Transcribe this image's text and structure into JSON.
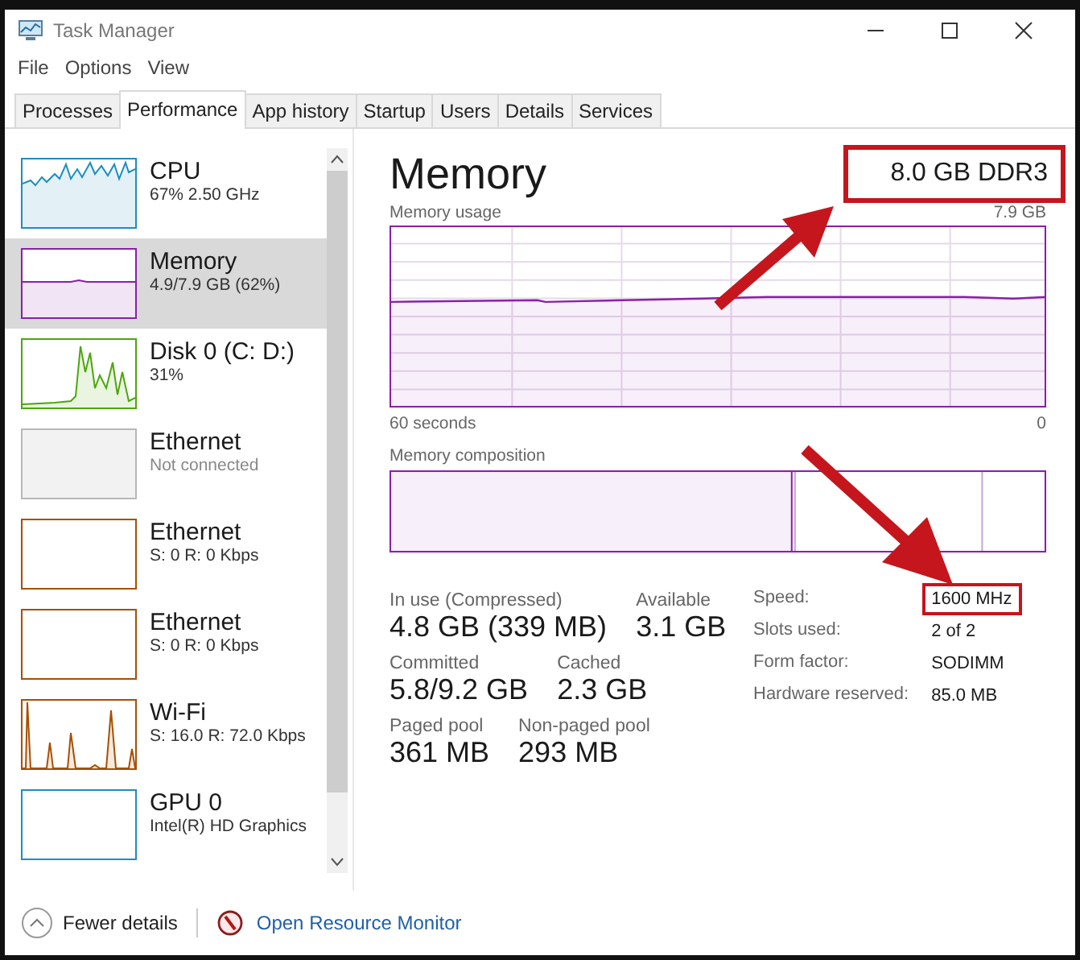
{
  "window": {
    "title": "Task Manager"
  },
  "menu": [
    "File",
    "Options",
    "View"
  ],
  "tabs": [
    {
      "label": "Processes",
      "selected": false
    },
    {
      "label": "Performance",
      "selected": true
    },
    {
      "label": "App history",
      "selected": false
    },
    {
      "label": "Startup",
      "selected": false
    },
    {
      "label": "Users",
      "selected": false
    },
    {
      "label": "Details",
      "selected": false
    },
    {
      "label": "Services",
      "selected": false
    }
  ],
  "sidebar": {
    "items": [
      {
        "name": "CPU",
        "detail": "67%  2.50 GHz",
        "kind": "cpu",
        "color": "#1c8ebf",
        "selected": false,
        "disabled": false
      },
      {
        "name": "Memory",
        "detail": "4.9/7.9 GB (62%)",
        "kind": "memory",
        "color": "#8b1fa8",
        "selected": true,
        "disabled": false
      },
      {
        "name": "Disk 0 (C: D:)",
        "detail": "31%",
        "kind": "disk",
        "color": "#4da60c",
        "selected": false,
        "disabled": false
      },
      {
        "name": "Ethernet",
        "detail": "Not connected",
        "kind": "empty",
        "color": "#b8b8b8",
        "selected": false,
        "disabled": true
      },
      {
        "name": "Ethernet",
        "detail": "S: 0 R: 0 Kbps",
        "kind": "empty",
        "color": "#a74f01",
        "selected": false,
        "disabled": false
      },
      {
        "name": "Ethernet",
        "detail": "S: 0 R: 0 Kbps",
        "kind": "empty",
        "color": "#a74f01",
        "selected": false,
        "disabled": false
      },
      {
        "name": "Wi-Fi",
        "detail": "S: 16.0 R: 72.0 Kbps",
        "kind": "wifi",
        "color": "#a74f01",
        "selected": false,
        "disabled": false
      },
      {
        "name": "GPU 0",
        "detail": "Intel(R) HD Graphics",
        "kind": "empty",
        "color": "#1c8ebf",
        "selected": false,
        "disabled": false
      }
    ]
  },
  "main": {
    "title": "Memory",
    "spec": "8.0 GB DDR3",
    "spec_highlighted": true,
    "usage_label": "Memory usage",
    "usage_max": "7.9 GB",
    "time_span": "60 seconds",
    "time_end": "0",
    "composition_label": "Memory composition",
    "stats": [
      {
        "label": "In use (Compressed)",
        "value": "4.8 GB (339 MB)"
      },
      {
        "label": "Available",
        "value": "3.1 GB"
      },
      {
        "label": "Committed",
        "value": "5.8/9.2 GB"
      },
      {
        "label": "Cached",
        "value": "2.3 GB"
      },
      {
        "label": "Paged pool",
        "value": "361 MB"
      },
      {
        "label": "Non-paged pool",
        "value": "293 MB"
      }
    ],
    "specs": [
      {
        "label": "Speed:",
        "value": "1600 MHz",
        "highlighted": true
      },
      {
        "label": "Slots used:",
        "value": "2 of 2",
        "highlighted": false
      },
      {
        "label": "Form factor:",
        "value": "SODIMM",
        "highlighted": false
      },
      {
        "label": "Hardware reserved:",
        "value": "85.0 MB",
        "highlighted": false
      }
    ]
  },
  "footer": {
    "fewer_details": "Fewer details",
    "monitor_link": "Open Resource Monitor"
  }
}
